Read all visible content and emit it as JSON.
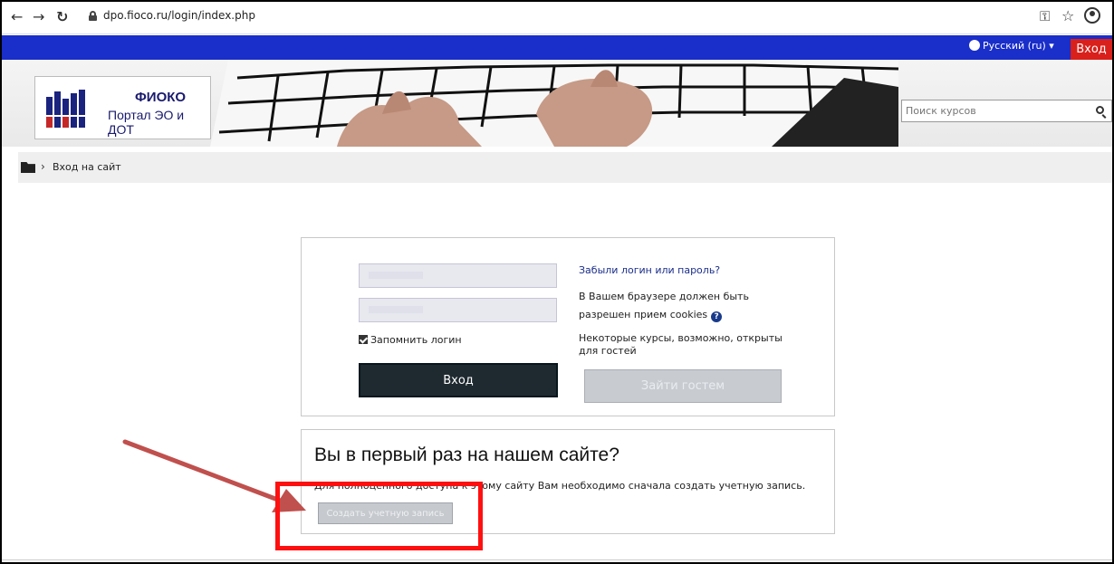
{
  "browser": {
    "url": "dpo.fioco.ru/login/index.php",
    "icons": [
      "back-arrow-icon",
      "forward-arrow-icon",
      "reload-icon",
      "lock-icon",
      "key-icon",
      "star-icon",
      "account-icon"
    ]
  },
  "navbar": {
    "language": "Русский (ru)",
    "login_label": "Вход",
    "colors": {
      "bar": "#1a2ec9",
      "login": "#d9201b"
    }
  },
  "header": {
    "logo_title": "ФИОКО",
    "logo_subtitle": "Портал ЭО и ДОТ",
    "search_placeholder": "Поиск курсов"
  },
  "breadcrumb": {
    "current": "Вход на сайт"
  },
  "login_form": {
    "username_value": "",
    "password_value": "",
    "remember_label": "Запомнить логин",
    "remember_checked": true,
    "login_button": "Вход",
    "forgot_link": "Забыли логин или пароль?",
    "cookies_line1": "В Вашем браузере должен быть",
    "cookies_line2": "разрешен прием cookies",
    "guests_line1": "Некоторые курсы, возможно, открыты",
    "guests_line2": "для гостей",
    "guest_button": "Зайти гостем"
  },
  "signup": {
    "title": "Вы в первый раз на нашем сайте?",
    "text": "Для полноценного доступа к этому сайту Вам необходимо сначала создать учетную запись.",
    "button": "Создать учетную запись"
  },
  "annotation": {
    "highlight_color": "#ff1010",
    "arrow_color": "#c0504d"
  }
}
